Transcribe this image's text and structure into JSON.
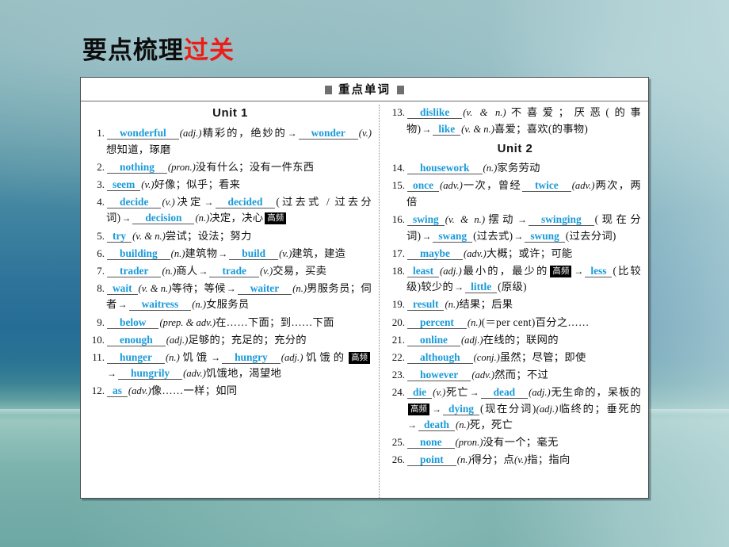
{
  "slide": {
    "title_black": "要点梳理",
    "title_red": "过关"
  },
  "panel": {
    "header": "重点单词",
    "header_marker": "■"
  },
  "columns": {
    "left": {
      "unit_heading": "Unit 1",
      "items": [
        {
          "num": "1.",
          "parts": [
            {
              "t": "ans",
              "v": "wonderful",
              "w": "wide"
            },
            {
              "t": "pos",
              "v": "(adj.)"
            },
            {
              "t": "cn",
              "v": "精彩的，绝妙的"
            },
            {
              "t": "arrow",
              "v": "→"
            },
            {
              "t": "ans",
              "v": "wonder",
              "w": "wide"
            },
            {
              "t": "pos",
              "v": "(v.)"
            },
            {
              "t": "cn",
              "v": "想知道，琢磨"
            }
          ]
        },
        {
          "num": "2.",
          "parts": [
            {
              "t": "ans",
              "v": "nothing",
              "w": "wide"
            },
            {
              "t": "pos",
              "v": "(pron.)"
            },
            {
              "t": "cn",
              "v": "没有什么；没有一件东西"
            }
          ]
        },
        {
          "num": "3.",
          "parts": [
            {
              "t": "ans",
              "v": "seem",
              "w": "narrow"
            },
            {
              "t": "pos",
              "v": "(v.)"
            },
            {
              "t": "cn",
              "v": "好像；似乎；看来"
            }
          ]
        },
        {
          "num": "4.",
          "parts": [
            {
              "t": "ans",
              "v": "decide",
              "w": "wide"
            },
            {
              "t": "pos",
              "v": "(v.)"
            },
            {
              "t": "cn",
              "v": "决定"
            },
            {
              "t": "arrow",
              "v": "→"
            },
            {
              "t": "ans",
              "v": "decided",
              "w": "wide"
            },
            {
              "t": "cn",
              "v": "(过去式 / 过去分词)"
            },
            {
              "t": "arrow",
              "v": "→"
            },
            {
              "t": "ans",
              "v": "decision",
              "w": "wide"
            },
            {
              "t": "pos",
              "v": "(n.)"
            },
            {
              "t": "cn",
              "v": "决定，决心"
            },
            {
              "t": "badge",
              "v": "高频"
            }
          ]
        },
        {
          "num": "5.",
          "parts": [
            {
              "t": "ans",
              "v": "try",
              "w": "narrow"
            },
            {
              "t": "pos",
              "v": "(v. & n.)"
            },
            {
              "t": "cn",
              "v": "尝试；设法；努力"
            }
          ]
        },
        {
          "num": "6.",
          "parts": [
            {
              "t": "ans",
              "v": "building",
              "w": "wide"
            },
            {
              "t": "pos",
              "v": "(n.)"
            },
            {
              "t": "cn",
              "v": "建筑物"
            },
            {
              "t": "arrow",
              "v": "→"
            },
            {
              "t": "ans",
              "v": "build",
              "w": "wide"
            },
            {
              "t": "pos",
              "v": "(v.)"
            },
            {
              "t": "cn",
              "v": "建筑，建造"
            }
          ]
        },
        {
          "num": "7.",
          "parts": [
            {
              "t": "ans",
              "v": "trader",
              "w": "wide"
            },
            {
              "t": "pos",
              "v": "(n.)"
            },
            {
              "t": "cn",
              "v": "商人"
            },
            {
              "t": "arrow",
              "v": "→"
            },
            {
              "t": "ans",
              "v": "trade",
              "w": "wide"
            },
            {
              "t": "pos",
              "v": "(v.)"
            },
            {
              "t": "cn",
              "v": "交易，买卖"
            }
          ]
        },
        {
          "num": "8.",
          "parts": [
            {
              "t": "ans",
              "v": "wait",
              "w": "narrow"
            },
            {
              "t": "pos",
              "v": "(v. & n.)"
            },
            {
              "t": "cn",
              "v": "等待；等候"
            },
            {
              "t": "arrow",
              "v": "→"
            },
            {
              "t": "ans",
              "v": "waiter",
              "w": "wide"
            },
            {
              "t": "pos",
              "v": "(n.)"
            },
            {
              "t": "cn",
              "v": "男服务员；伺者"
            },
            {
              "t": "arrow",
              "v": "→"
            },
            {
              "t": "ans",
              "v": "waitress",
              "w": "wide"
            },
            {
              "t": "pos",
              "v": "(n.)"
            },
            {
              "t": "cn",
              "v": "女服务员"
            }
          ]
        },
        {
          "num": "9.",
          "parts": [
            {
              "t": "ans",
              "v": "below",
              "w": "wide"
            },
            {
              "t": "pos",
              "v": "(prep. & adv.)"
            },
            {
              "t": "cn",
              "v": "在……下面；到……下面"
            }
          ]
        },
        {
          "num": "10.",
          "parts": [
            {
              "t": "ans",
              "v": "enough",
              "w": "wide"
            },
            {
              "t": "pos",
              "v": "(adj.)"
            },
            {
              "t": "cn",
              "v": "足够的；充足的；充分的"
            }
          ]
        },
        {
          "num": "11.",
          "parts": [
            {
              "t": "ans",
              "v": "hunger",
              "w": "wide"
            },
            {
              "t": "pos",
              "v": "(n.)"
            },
            {
              "t": "cn",
              "v": "饥饿"
            },
            {
              "t": "arrow",
              "v": "→"
            },
            {
              "t": "ans",
              "v": "hungry",
              "w": "wide"
            },
            {
              "t": "pos",
              "v": "(adj.)"
            },
            {
              "t": "cn",
              "v": "饥饿的"
            },
            {
              "t": "badge",
              "v": "高频"
            },
            {
              "t": "arrow",
              "v": "→"
            },
            {
              "t": "ans",
              "v": "hungrily",
              "w": "wide"
            },
            {
              "t": "pos",
              "v": "(adv.)"
            },
            {
              "t": "cn",
              "v": "饥饿地，渴望地"
            }
          ]
        },
        {
          "num": "12.",
          "parts": [
            {
              "t": "ans",
              "v": "as",
              "w": "narrow"
            },
            {
              "t": "pos",
              "v": "(adv.)"
            },
            {
              "t": "cn",
              "v": "像……一样；如同"
            }
          ]
        }
      ]
    },
    "right": {
      "unit_heading": "Unit 2",
      "items_before_unit": [
        {
          "num": "13.",
          "parts": [
            {
              "t": "ans",
              "v": "dislike",
              "w": "wide"
            },
            {
              "t": "pos",
              "v": "(v. & n.)"
            },
            {
              "t": "cn",
              "v": "不喜爱；厌恶(的事物)"
            },
            {
              "t": "arrow",
              "v": "→"
            },
            {
              "t": "ans",
              "v": "like",
              "w": "narrow"
            },
            {
              "t": "pos",
              "v": "(v. & n.)"
            },
            {
              "t": "cn",
              "v": "喜爱；喜欢(的事物)"
            }
          ]
        }
      ],
      "items": [
        {
          "num": "14.",
          "parts": [
            {
              "t": "ans",
              "v": "housework",
              "w": "wide"
            },
            {
              "t": "pos",
              "v": "(n.)"
            },
            {
              "t": "cn",
              "v": "家务劳动"
            }
          ]
        },
        {
          "num": "15.",
          "parts": [
            {
              "t": "ans",
              "v": "once",
              "w": "narrow"
            },
            {
              "t": "pos",
              "v": "(adv.)"
            },
            {
              "t": "cn",
              "v": "一次，曾经"
            },
            {
              "t": "ans",
              "v": "twice",
              "w": "wide"
            },
            {
              "t": "pos",
              "v": "(adv.)"
            },
            {
              "t": "cn",
              "v": "两次，两倍"
            }
          ]
        },
        {
          "num": "16.",
          "parts": [
            {
              "t": "ans",
              "v": "swing",
              "w": "narrow"
            },
            {
              "t": "pos",
              "v": "(v. & n.)"
            },
            {
              "t": "cn",
              "v": "摆动"
            },
            {
              "t": "arrow",
              "v": "→"
            },
            {
              "t": "ans",
              "v": "swinging",
              "w": "wide"
            },
            {
              "t": "cn",
              "v": "(现在分词)"
            },
            {
              "t": "arrow",
              "v": "→"
            },
            {
              "t": "ans",
              "v": "swang",
              "w": "narrow"
            },
            {
              "t": "cn",
              "v": "(过去式)"
            },
            {
              "t": "arrow",
              "v": "→"
            },
            {
              "t": "ans",
              "v": "swung",
              "w": "narrow"
            },
            {
              "t": "cn",
              "v": "(过去分词)"
            }
          ]
        },
        {
          "num": "17.",
          "parts": [
            {
              "t": "ans",
              "v": "maybe",
              "w": "wide"
            },
            {
              "t": "pos",
              "v": "(adv.)"
            },
            {
              "t": "cn",
              "v": "大概；或许；可能"
            }
          ]
        },
        {
          "num": "18.",
          "parts": [
            {
              "t": "ans",
              "v": "least",
              "w": "narrow"
            },
            {
              "t": "pos",
              "v": "(adj.)"
            },
            {
              "t": "cn",
              "v": "最小的，最少的"
            },
            {
              "t": "badge",
              "v": "高频"
            },
            {
              "t": "arrow",
              "v": "→"
            },
            {
              "t": "ans",
              "v": "less",
              "w": "narrow"
            },
            {
              "t": "cn",
              "v": "(比较级)较少的"
            },
            {
              "t": "arrow",
              "v": "→"
            },
            {
              "t": "ans",
              "v": "little",
              "w": "narrow"
            },
            {
              "t": "cn",
              "v": "(原级)"
            }
          ]
        },
        {
          "num": "19.",
          "parts": [
            {
              "t": "ans",
              "v": "result",
              "w": "narrow"
            },
            {
              "t": "pos",
              "v": "(n.)"
            },
            {
              "t": "cn",
              "v": "结果；后果"
            }
          ]
        },
        {
          "num": "20.",
          "parts": [
            {
              "t": "ans",
              "v": "percent",
              "w": "wide"
            },
            {
              "t": "pos",
              "v": "(n.)"
            },
            {
              "t": "cn",
              "v": "(＝per cent)百分之……"
            }
          ]
        },
        {
          "num": "21.",
          "parts": [
            {
              "t": "ans",
              "v": "online",
              "w": "wide"
            },
            {
              "t": "pos",
              "v": "(adj.)"
            },
            {
              "t": "cn",
              "v": "在线的；联网的"
            }
          ]
        },
        {
          "num": "22.",
          "parts": [
            {
              "t": "ans",
              "v": "although",
              "w": "wide"
            },
            {
              "t": "pos",
              "v": "(conj.)"
            },
            {
              "t": "cn",
              "v": "虽然；尽管；即使"
            }
          ]
        },
        {
          "num": "23.",
          "parts": [
            {
              "t": "ans",
              "v": "however",
              "w": "wide"
            },
            {
              "t": "pos",
              "v": "(adv.)"
            },
            {
              "t": "cn",
              "v": "然而；不过"
            }
          ]
        },
        {
          "num": "24.",
          "parts": [
            {
              "t": "ans",
              "v": "die",
              "w": "narrow"
            },
            {
              "t": "pos",
              "v": "(v.)"
            },
            {
              "t": "cn",
              "v": "死亡"
            },
            {
              "t": "arrow",
              "v": "→"
            },
            {
              "t": "ans",
              "v": "dead",
              "w": "wide"
            },
            {
              "t": "pos",
              "v": "(adj.)"
            },
            {
              "t": "cn",
              "v": "无生命的，呆板的"
            },
            {
              "t": "badge",
              "v": "高频"
            },
            {
              "t": "arrow",
              "v": "→"
            },
            {
              "t": "ans",
              "v": "dying",
              "w": "narrow"
            },
            {
              "t": "cn",
              "v": "(现在分词)"
            },
            {
              "t": "pos",
              "v": "(adj.)"
            },
            {
              "t": "cn",
              "v": "临终的；垂死的"
            },
            {
              "t": "arrow",
              "v": "→"
            },
            {
              "t": "ans",
              "v": "death",
              "w": "narrow"
            },
            {
              "t": "pos",
              "v": "(n.)"
            },
            {
              "t": "cn",
              "v": "死，死亡"
            }
          ]
        },
        {
          "num": "25.",
          "parts": [
            {
              "t": "ans",
              "v": "none",
              "w": "wide"
            },
            {
              "t": "pos",
              "v": "(pron.)"
            },
            {
              "t": "cn",
              "v": "没有一个；毫无"
            }
          ]
        },
        {
          "num": "26.",
          "parts": [
            {
              "t": "ans",
              "v": "point",
              "w": "wide"
            },
            {
              "t": "pos",
              "v": "(n.)"
            },
            {
              "t": "cn",
              "v": "得分；点"
            },
            {
              "t": "pos",
              "v": "(v.)"
            },
            {
              "t": "cn",
              "v": "指；指向"
            }
          ]
        }
      ]
    }
  },
  "colors": {
    "answer_blue": "#1a9ad8",
    "title_red": "#ee1c15",
    "badge_bg": "#000000"
  }
}
